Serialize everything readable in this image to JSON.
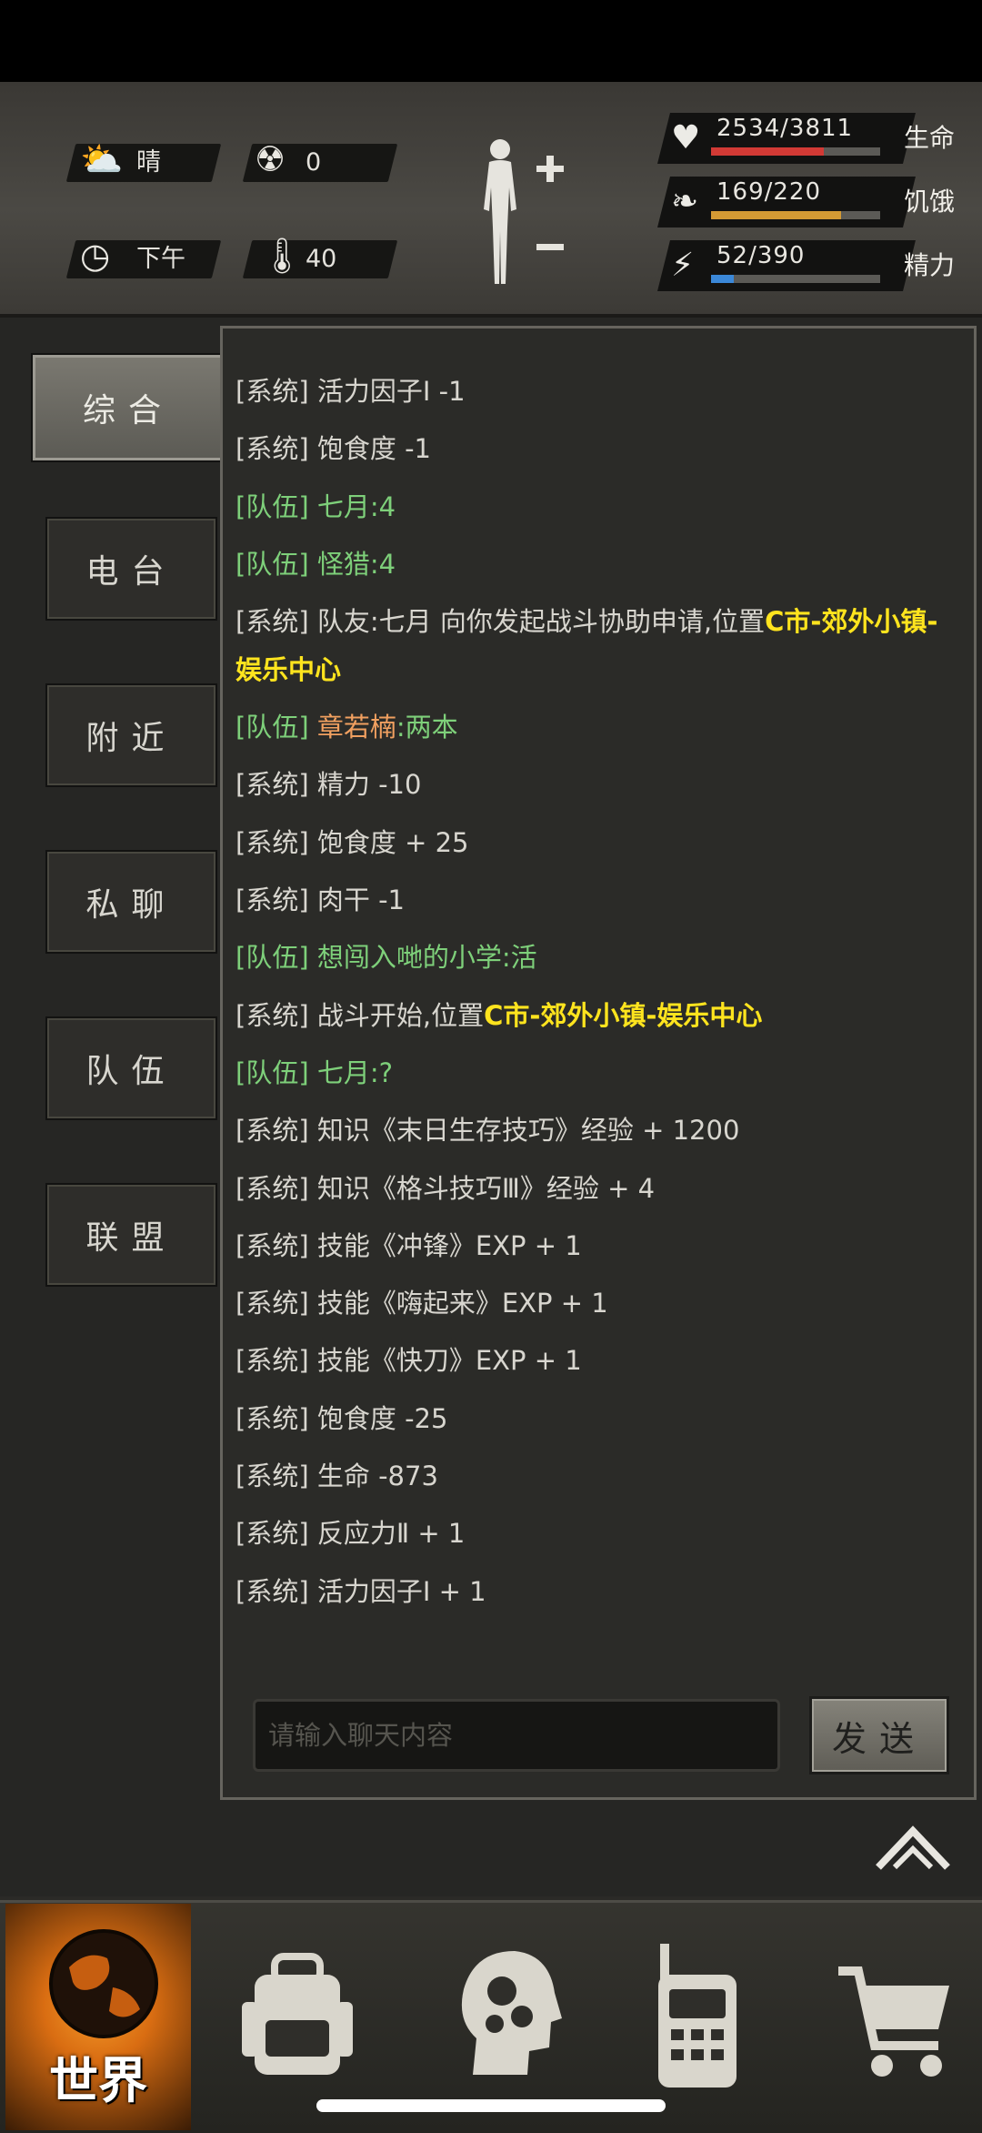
{
  "hud": {
    "weather": {
      "icon": "partly-cloudy-icon",
      "label": "晴"
    },
    "radiation": {
      "icon": "radiation-icon",
      "value": "0"
    },
    "time": {
      "icon": "clock-icon",
      "label": "下午"
    },
    "temperature": {
      "icon": "thermometer-icon",
      "value": "40"
    },
    "stats": [
      {
        "icon": "heart-pulse-icon",
        "text": "2534/3811",
        "label": "生命",
        "fraction": 0.665,
        "color": "#d23a35"
      },
      {
        "icon": "stomach-icon",
        "text": "169/220",
        "label": "饥饿",
        "fraction": 0.768,
        "color": "#d49a34"
      },
      {
        "icon": "energy-head-icon",
        "text": "52/390",
        "label": "精力",
        "fraction": 0.133,
        "color": "#3b88d8"
      }
    ]
  },
  "tabs": [
    {
      "label": "综合",
      "active": true
    },
    {
      "label": "电台",
      "active": false
    },
    {
      "label": "附近",
      "active": false
    },
    {
      "label": "私聊",
      "active": false
    },
    {
      "label": "队伍",
      "active": false
    },
    {
      "label": "联盟",
      "active": false
    }
  ],
  "chat": {
    "messages": [
      {
        "type": "system",
        "tag": "[系统]",
        "text": "活力因子Ⅰ -1"
      },
      {
        "type": "system",
        "tag": "[系统]",
        "text": "饱食度 -1"
      },
      {
        "type": "team",
        "tag": "[队伍]",
        "sender": "七月",
        "text": ":4"
      },
      {
        "type": "team",
        "tag": "[队伍]",
        "sender": "怪猎",
        "text": ":4"
      },
      {
        "type": "system",
        "tag": "[系统]",
        "text": "队友:七月 向你发起战斗协助申请,位置",
        "highlight": "C市-郊外小镇-娱乐中心",
        "wrap": true
      },
      {
        "type": "team",
        "tag": "[队伍]",
        "sender": "章若楠",
        "sender_color": "orange",
        "text": ":两本"
      },
      {
        "type": "system",
        "tag": "[系统]",
        "text": "精力 -10"
      },
      {
        "type": "system",
        "tag": "[系统]",
        "text": "饱食度 + 25"
      },
      {
        "type": "system",
        "tag": "[系统]",
        "text": "肉干 -1"
      },
      {
        "type": "team",
        "tag": "[队伍]",
        "sender": "想闯入哋的小学",
        "text": ":活"
      },
      {
        "type": "system",
        "tag": "[系统]",
        "text": "战斗开始,位置",
        "highlight": "C市-郊外小镇-娱乐中心"
      },
      {
        "type": "team",
        "tag": "[队伍]",
        "sender": "七月",
        "text": ":?"
      },
      {
        "type": "system",
        "tag": "[系统]",
        "text": "知识《末日生存技巧》经验 + 1200"
      },
      {
        "type": "system",
        "tag": "[系统]",
        "text": "知识《格斗技巧Ⅲ》经验 + 4"
      },
      {
        "type": "system",
        "tag": "[系统]",
        "text": "技能《冲锋》EXP + 1"
      },
      {
        "type": "system",
        "tag": "[系统]",
        "text": "技能《嗨起来》EXP + 1"
      },
      {
        "type": "system",
        "tag": "[系统]",
        "text": "技能《快刀》EXP + 1"
      },
      {
        "type": "system",
        "tag": "[系统]",
        "text": "饱食度 -25"
      },
      {
        "type": "system",
        "tag": "[系统]",
        "text": "生命 -873"
      },
      {
        "type": "system",
        "tag": "[系统]",
        "text": "反应力Ⅱ + 1"
      },
      {
        "type": "system",
        "tag": "[系统]",
        "text": "活力因子Ⅰ + 1"
      }
    ],
    "input_placeholder": "请输入聊天内容",
    "send_label": "发送"
  },
  "bottom_nav": {
    "world_label": "世界",
    "items": [
      {
        "icon": "globe-icon"
      },
      {
        "icon": "backpack-icon"
      },
      {
        "icon": "brain-gears-icon"
      },
      {
        "icon": "walkie-talkie-icon"
      },
      {
        "icon": "shopping-cart-icon"
      }
    ]
  }
}
